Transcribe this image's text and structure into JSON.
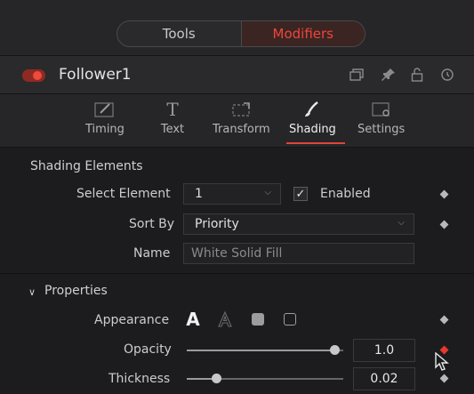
{
  "mode_tabs": [
    {
      "label": "Tools",
      "active": false
    },
    {
      "label": "Modifiers",
      "active": true
    }
  ],
  "header": {
    "tool_name": "Follower1",
    "enabled": true,
    "icons": [
      "panels-icon",
      "pin-icon",
      "lock-icon",
      "reset-icon"
    ]
  },
  "tabs": [
    {
      "label": "Timing",
      "icon": "timing-icon"
    },
    {
      "label": "Text",
      "icon": "text-icon"
    },
    {
      "label": "Transform",
      "icon": "transform-icon"
    },
    {
      "label": "Shading",
      "icon": "shading-icon",
      "active": true
    },
    {
      "label": "Settings",
      "icon": "settings-icon"
    }
  ],
  "shading": {
    "section_title": "Shading Elements",
    "select_element": {
      "label": "Select Element",
      "value": "1"
    },
    "enabled": {
      "label": "Enabled",
      "checked": true
    },
    "sort_by": {
      "label": "Sort By",
      "value": "Priority"
    },
    "name": {
      "label": "Name",
      "value": "White Solid Fill"
    }
  },
  "properties": {
    "section_title": "Properties",
    "appearance": {
      "label": "Appearance",
      "options": [
        "solid-text",
        "outline-text",
        "solid-block",
        "outline-block"
      ]
    },
    "opacity": {
      "label": "Opacity",
      "value": "1.0",
      "fraction": 1.0,
      "keyframed": true
    },
    "thickness": {
      "label": "Thickness",
      "value": "0.02",
      "fraction": 0.2
    }
  },
  "colors": {
    "accent": "#e0453a",
    "background": "#1c1c1e"
  }
}
